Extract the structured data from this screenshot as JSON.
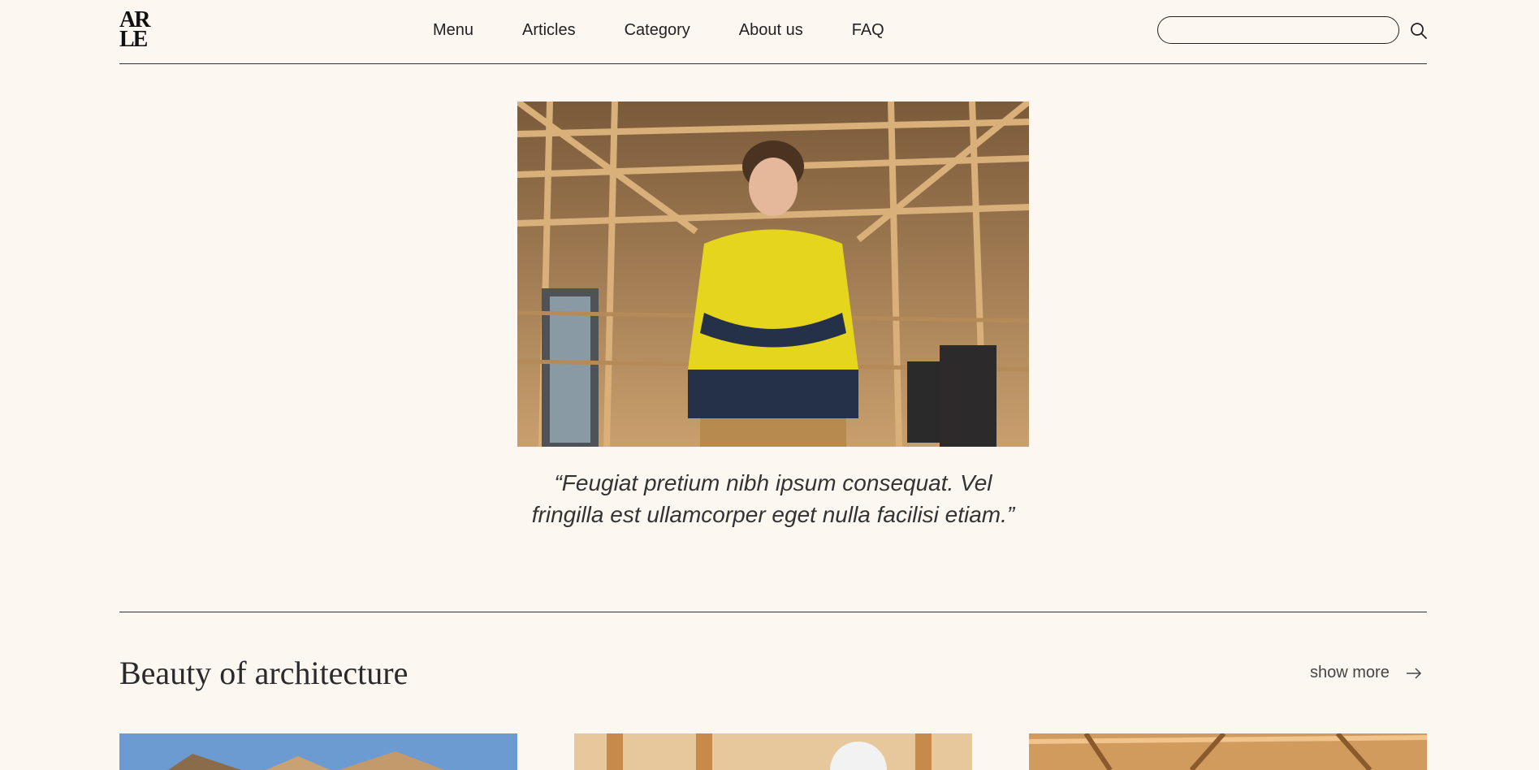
{
  "header": {
    "logo": {
      "line1": "AR",
      "line2": "LE"
    },
    "nav": [
      "Menu",
      "Articles",
      "Category",
      "About us",
      "FAQ"
    ],
    "search_placeholder": ""
  },
  "hero": {
    "quote_line1": "“Feugiat pretium nibh ipsum consequat. Vel",
    "quote_line2": "fringilla est ullamcorper eget nulla facilisi etiam.”"
  },
  "section": {
    "title": "Beauty of architecture",
    "show_more": "show more"
  },
  "colors": {
    "background": "#fdf7f2",
    "text": "#1f1f1f",
    "divider": "#333333"
  }
}
